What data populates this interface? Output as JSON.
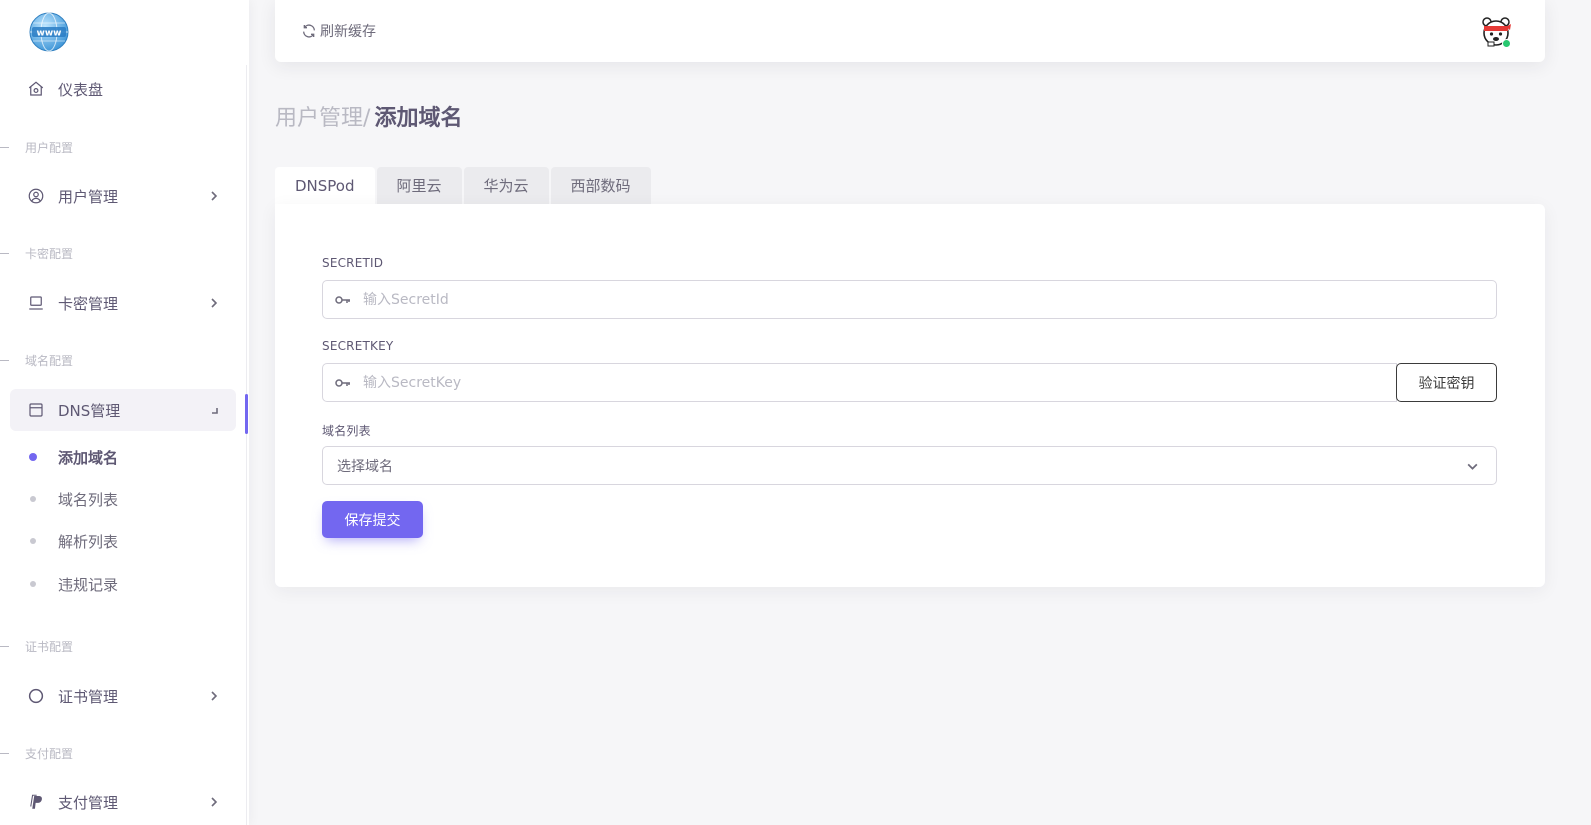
{
  "sidebar": {
    "dashboard_label": "仪表盘",
    "sections": {
      "user_config": "用户配置",
      "card_config": "卡密配置",
      "domain_config": "域名配置",
      "cert_config": "证书配置",
      "pay_config": "支付配置"
    },
    "items": {
      "user_manage": "用户管理",
      "card_manage": "卡密管理",
      "dns_manage": "DNS管理",
      "cert_manage": "证书管理",
      "pay_manage": "支付管理"
    },
    "dns_sub_items": [
      "添加域名",
      "域名列表",
      "解析列表",
      "违规记录"
    ],
    "active_sub_item": "添加域名"
  },
  "navbar": {
    "refresh_label": "刷新缓存"
  },
  "breadcrumb": {
    "parent": "用户管理",
    "separator": "/",
    "current": "添加域名"
  },
  "tabs": [
    "DNSPod",
    "阿里云",
    "华为云",
    "西部数码"
  ],
  "active_tab": "DNSPod",
  "form": {
    "secretid_label": "SECRETID",
    "secretid_placeholder": "输入SecretId",
    "secretid_value": "",
    "secretkey_label": "SECRETKEY",
    "secretkey_placeholder": "输入SecretKey",
    "secretkey_value": "",
    "verify_button": "验证密钥",
    "domain_list_label": "域名列表",
    "domain_select_value": "选择域名",
    "submit_button": "保存提交"
  },
  "colors": {
    "primary": "#7367f0",
    "online_status": "#28c76f",
    "text": "#5e5873",
    "muted": "#b9b9c3"
  }
}
